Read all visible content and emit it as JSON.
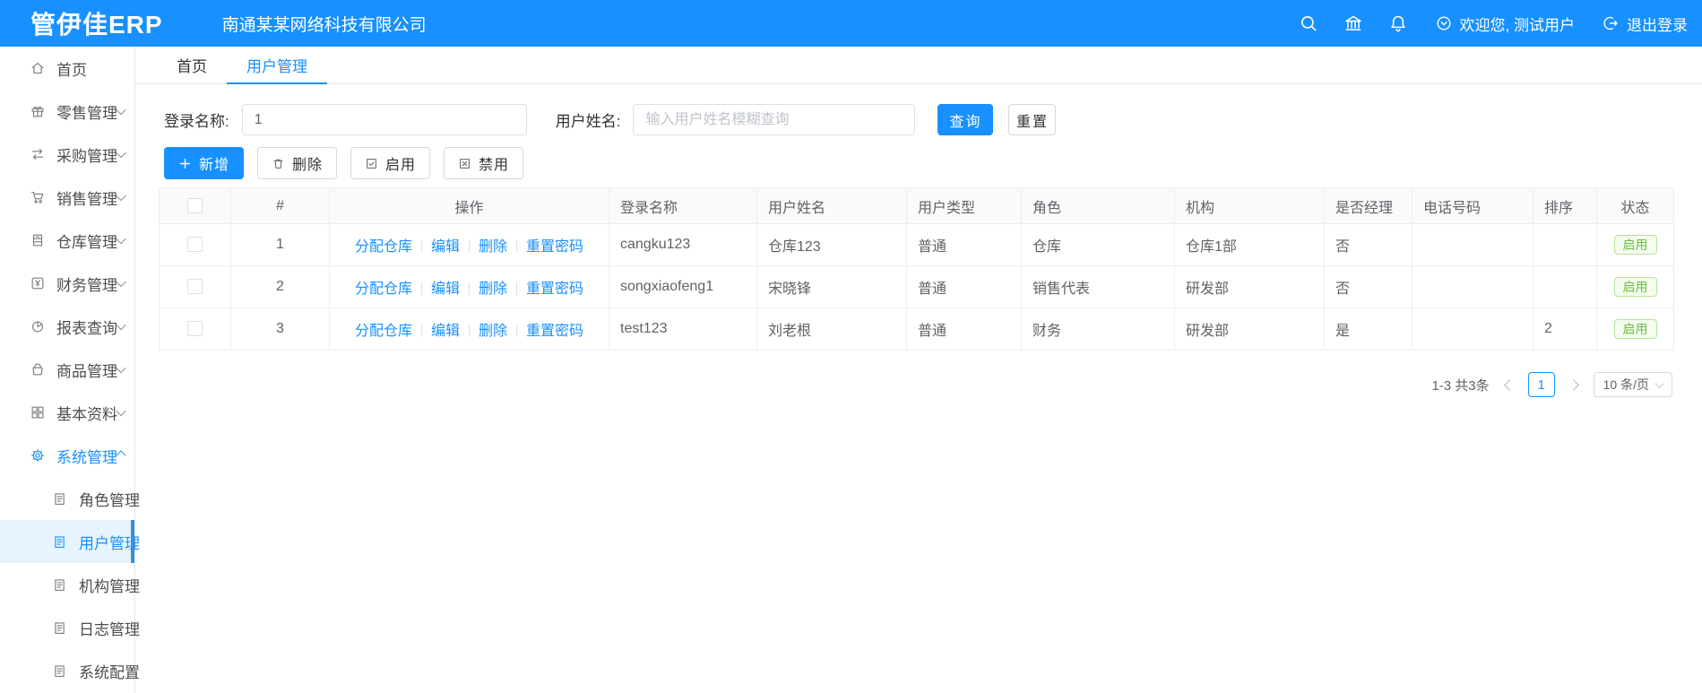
{
  "topbar": {
    "logo": "管伊佳ERP",
    "company": "南通某某网络科技有限公司",
    "welcome": "欢迎您, 测试用户",
    "logout": "退出登录"
  },
  "sidebar": {
    "items": [
      {
        "key": "home",
        "label": "首页",
        "icon": "home"
      },
      {
        "key": "retail",
        "label": "零售管理",
        "icon": "gift",
        "chevron": "down"
      },
      {
        "key": "purchase",
        "label": "采购管理",
        "icon": "swap",
        "chevron": "down"
      },
      {
        "key": "sales",
        "label": "销售管理",
        "icon": "cart",
        "chevron": "down"
      },
      {
        "key": "warehouse",
        "label": "仓库管理",
        "icon": "warehouse",
        "chevron": "down"
      },
      {
        "key": "finance",
        "label": "财务管理",
        "icon": "finance",
        "chevron": "down"
      },
      {
        "key": "reports",
        "label": "报表查询",
        "icon": "pie",
        "chevron": "down"
      },
      {
        "key": "goods",
        "label": "商品管理",
        "icon": "bag",
        "chevron": "down"
      },
      {
        "key": "basic-data",
        "label": "基本资料",
        "icon": "grid",
        "chevron": "down"
      },
      {
        "key": "system",
        "label": "系统管理",
        "icon": "gear",
        "chevron": "up",
        "active": true,
        "children": [
          {
            "key": "role-mgmt",
            "label": "角色管理",
            "icon": "doc"
          },
          {
            "key": "user-mgmt",
            "label": "用户管理",
            "icon": "doc",
            "selected": true
          },
          {
            "key": "org-mgmt",
            "label": "机构管理",
            "icon": "doc"
          },
          {
            "key": "log-mgmt",
            "label": "日志管理",
            "icon": "doc"
          },
          {
            "key": "system-config",
            "label": "系统配置",
            "icon": "doc"
          }
        ]
      }
    ]
  },
  "tabs": [
    {
      "label": "首页",
      "active": false
    },
    {
      "label": "用户管理",
      "active": true
    }
  ],
  "search": {
    "login_label": "登录名称:",
    "login_value": "1",
    "name_label": "用户姓名:",
    "name_placeholder": "输入用户姓名模糊查询",
    "query": "查询",
    "reset": "重置"
  },
  "toolbar": {
    "add": "新增",
    "delete": "删除",
    "enable": "启用",
    "disable": "禁用"
  },
  "table": {
    "headers": [
      "#",
      "操作",
      "登录名称",
      "用户姓名",
      "用户类型",
      "角色",
      "机构",
      "是否经理",
      "电话号码",
      "排序",
      "状态"
    ],
    "ops": [
      "分配仓库",
      "编辑",
      "删除",
      "重置密码"
    ],
    "rows": [
      {
        "index": "1",
        "login": "cangku123",
        "name": "仓库123",
        "type": "普通",
        "role": "仓库",
        "org": "仓库1部",
        "manager": "否",
        "phone": "",
        "sort": "",
        "status": "启用"
      },
      {
        "index": "2",
        "login": "songxiaofeng1",
        "name": "宋晓锋",
        "type": "普通",
        "role": "销售代表",
        "org": "研发部",
        "manager": "否",
        "phone": "",
        "sort": "",
        "status": "启用"
      },
      {
        "index": "3",
        "login": "test123",
        "name": "刘老根",
        "type": "普通",
        "role": "财务",
        "org": "研发部",
        "manager": "是",
        "phone": "",
        "sort": "2",
        "status": "启用"
      }
    ]
  },
  "pagination": {
    "total": "1-3 共3条",
    "page": "1",
    "per_page": "10 条/页"
  },
  "colors": {
    "primary": "#1890ff",
    "success": "#67c23a",
    "selected_bg": "#e7f4fc"
  }
}
